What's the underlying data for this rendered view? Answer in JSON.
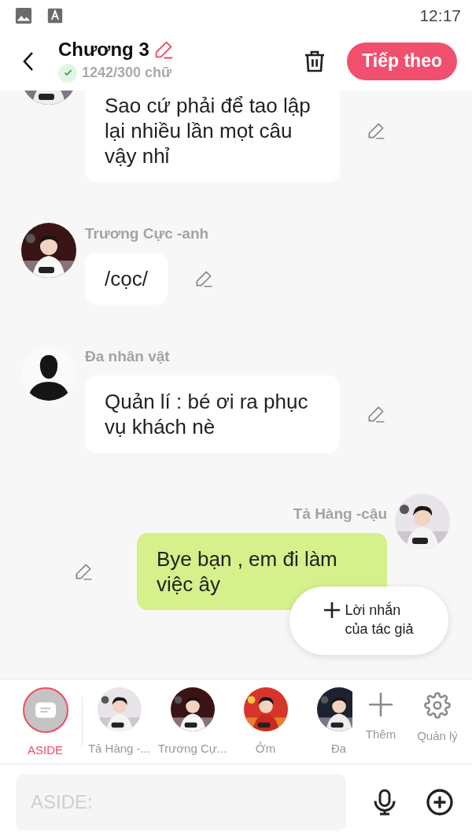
{
  "status_bar": {
    "time": "12:17"
  },
  "header": {
    "title": "Chương 3",
    "word_count": "1242/300 chữ",
    "word_count_ok": true,
    "next_button": "Tiếp theo"
  },
  "messages": [
    {
      "kind": "incoming",
      "text": "Sao cứ phải để tao lập lại nhiều lần mọt câu vậy nhỉ"
    },
    {
      "kind": "incoming",
      "name": "Trương Cực -anh",
      "text": "/cọc/"
    },
    {
      "kind": "incoming",
      "name": "Đa nhân vật",
      "text": "Quản lí : bé ơi ra phục vụ khách nè",
      "avatar": {
        "kind": "silhouette"
      }
    },
    {
      "kind": "outgoing",
      "name": "Tả Hàng -cậu",
      "text": "Bye bạn , em đi làm việc ây"
    }
  ],
  "author_note_button": "Lời nhắn\ncủa tác giả",
  "characters": [
    {
      "kind": "aside",
      "label": "ASIDE",
      "selected": true
    },
    {
      "label": "Tả Hàng -...",
      "selected": false
    },
    {
      "label": "Trương Cự...",
      "selected": false
    },
    {
      "label": "Ởm",
      "selected": false
    },
    {
      "label": "Đa",
      "selected": false
    }
  ],
  "actions": [
    {
      "kind": "add",
      "label": "Thêm"
    },
    {
      "kind": "manage",
      "label": "Quản lý"
    }
  ],
  "input": {
    "placeholder": "ASIDE:"
  }
}
